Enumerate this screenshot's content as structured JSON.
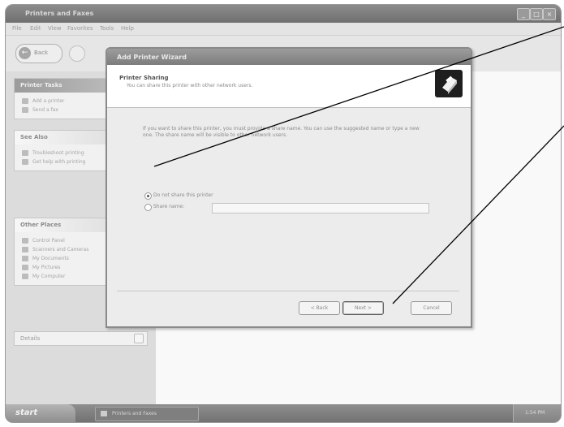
{
  "window": {
    "title": "Printers and Faxes",
    "menu": [
      "File",
      "Edit",
      "View",
      "Favorites",
      "Tools",
      "Help"
    ],
    "controls": [
      "_",
      "□",
      "×"
    ]
  },
  "toolbar": {
    "back_label": "Back"
  },
  "sidebar": {
    "printer_tasks": {
      "title": "Printer Tasks",
      "items": [
        "Add a printer",
        "Send a fax"
      ]
    },
    "see_also": {
      "title": "See Also",
      "items": [
        "Troubleshoot printing",
        "Get help with printing"
      ]
    },
    "other_places": {
      "title": "Other Places",
      "items": [
        "Control Panel",
        "Scanners and Cameras",
        "My Documents",
        "My Pictures",
        "My Computer"
      ]
    },
    "details": {
      "title": "Details"
    }
  },
  "wizard": {
    "title": "Add Printer Wizard",
    "heading": "Printer Sharing",
    "subheading": "You can share this printer with other network users.",
    "body": "If you want to share this printer, you must provide a share name. You can use the suggested name or type a new one. The share name will be visible to other network users.",
    "options": [
      {
        "label": "Do not share this printer",
        "checked": true
      },
      {
        "label": "Share name:",
        "checked": false
      }
    ],
    "share_name_value": "",
    "buttons": {
      "back": "< Back",
      "next": "Next >",
      "cancel": "Cancel"
    }
  },
  "taskbar": {
    "start_label": "start",
    "task_label": "Printers and Faxes",
    "clock": "1:54 PM"
  },
  "colors": {
    "callout_line": "#000000"
  }
}
